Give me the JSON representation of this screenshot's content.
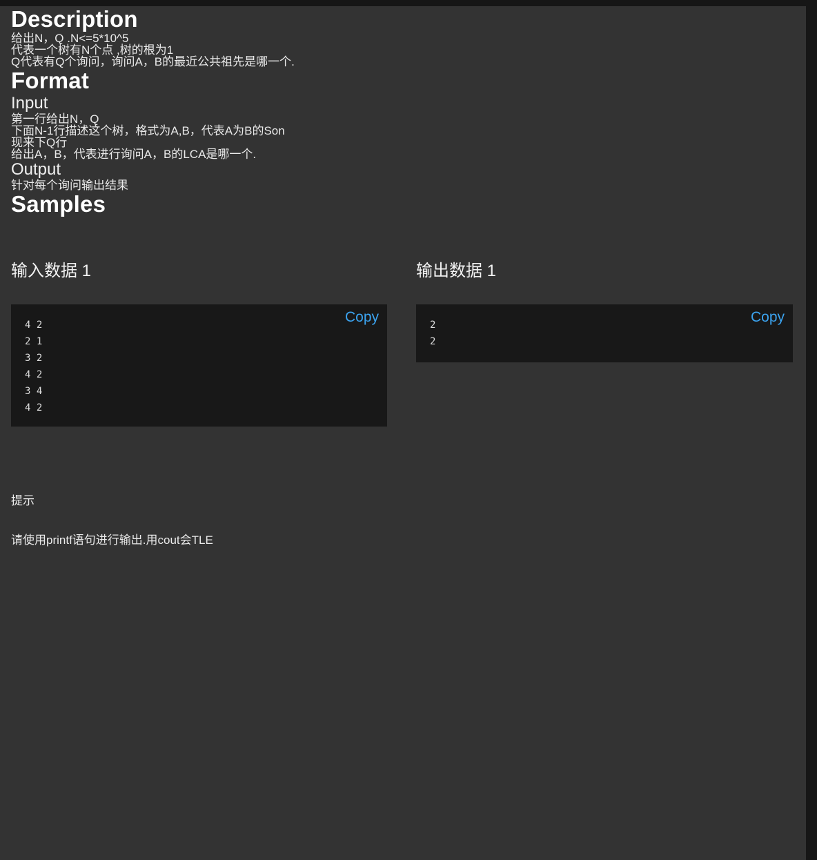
{
  "colors": {
    "page_bg": "#333333",
    "outer_bg": "#161616",
    "code_bg": "#181818",
    "heading": "#ffffff",
    "body_text": "#e9e9e9",
    "link_accent": "#3ba3ef"
  },
  "description": {
    "heading": "Description",
    "paragraphs": [
      "给出N，Q .N<=5*10^5",
      "代表一个树有N个点 ,树的根为1",
      "Q代表有Q个询问，询问A，B的最近公共祖先是哪一个."
    ]
  },
  "format": {
    "heading": "Format",
    "input": {
      "subheading": "Input",
      "paragraphs": [
        "第一行给出N，Q",
        "下面N-1行描述这个树，格式为A,B，代表A为B的Son",
        "现来下Q行",
        "给出A，B，代表进行询问A，B的LCA是哪一个."
      ]
    },
    "output": {
      "subheading": "Output",
      "paragraphs": [
        "针对每个询问输出结果"
      ]
    }
  },
  "samples": {
    "heading": "Samples",
    "copy_label": "Copy",
    "input": {
      "title": "输入数据 1",
      "content": "4 2\n2 1\n3 2\n4 2\n3 4\n4 2"
    },
    "output": {
      "title": "输出数据 1",
      "content": "2\n2"
    }
  },
  "hint": {
    "title": "提示",
    "text": "请使用printf语句进行输出.用cout会TLE"
  }
}
